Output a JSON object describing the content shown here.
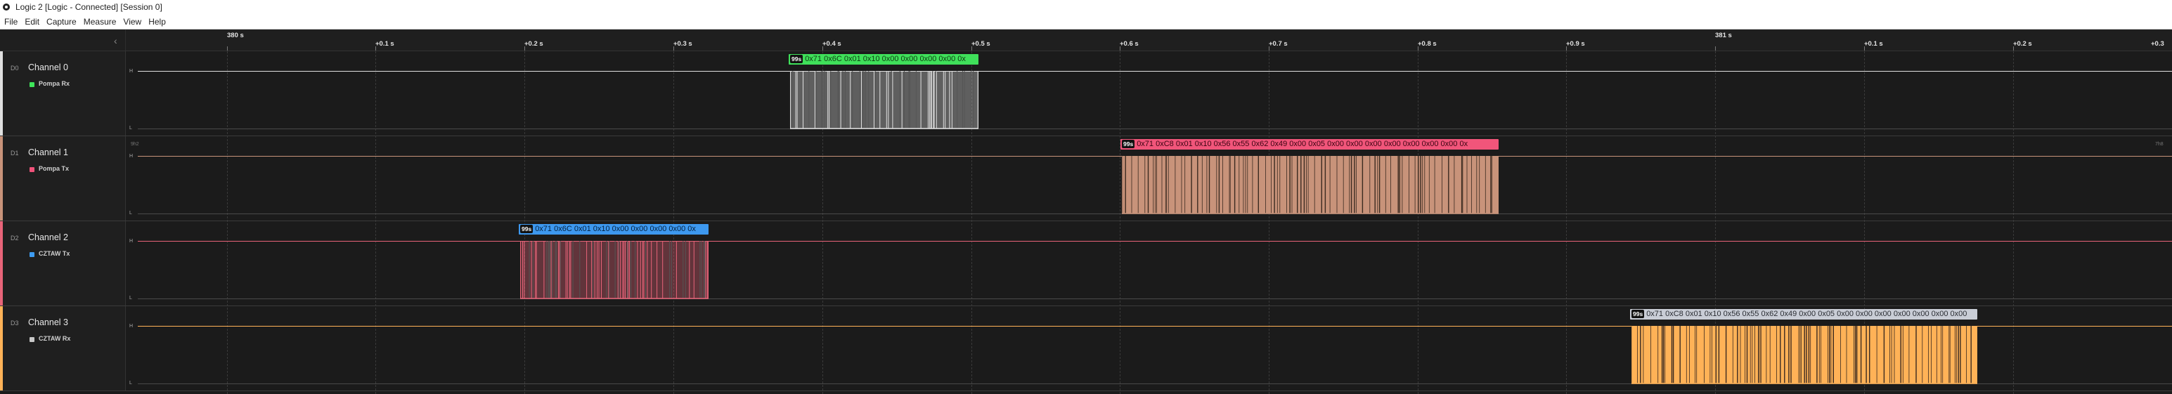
{
  "window": {
    "title": "Logic 2 [Logic - Connected] [Session 0]"
  },
  "menu": [
    "File",
    "Edit",
    "Capture",
    "Measure",
    "View",
    "Help"
  ],
  "ruler": {
    "labels": [
      "380 s",
      "+0.1 s",
      "+0.2 s",
      "+0.3 s",
      "+0.4 s",
      "+0.5 s",
      "+0.6 s",
      "+0.7 s",
      "+0.8 s",
      "+0.9 s",
      "381 s",
      "+0.1 s",
      "+0.2 s",
      "+0.3"
    ]
  },
  "channels": [
    {
      "id": "D0",
      "name": "Channel 0",
      "analyzer": "Pompa Rx",
      "color": "#e0e0e0",
      "analyzer_color": "#3ee65a",
      "high": "H",
      "low": "L",
      "packet": {
        "badge": "99s",
        "text": "0x71 0x6C 0x01 0x10 0x00 0x00 0x00 0x00 0x",
        "bg": "#3fe05a",
        "fg": "#0f3a12"
      }
    },
    {
      "id": "D1",
      "name": "Channel 1",
      "analyzer": "Pompa Tx",
      "color": "#c8937a",
      "analyzer_color": "#f0527a",
      "high": "H",
      "low": "L",
      "corner_left": "9h2",
      "corner_right": "7h8",
      "packet": {
        "badge": "99s",
        "text": "0x71 0xC8 0x01 0x10 0x56 0x55 0x62 0x49 0x00 0x05 0x00 0x00 0x00 0x00 0x00 0x00 0x00 0x",
        "bg": "#f1557a",
        "fg": "#3b0412"
      }
    },
    {
      "id": "D2",
      "name": "Channel 2",
      "analyzer": "CZTAW Tx",
      "color": "#e86479",
      "analyzer_color": "#3d9cf2",
      "high": "H",
      "low": "L",
      "packet": {
        "badge": "99s",
        "text": "0x71 0x6C 0x01 0x10 0x00 0x00 0x00 0x00 0x",
        "bg": "#3d98ef",
        "fg": "#04213f"
      }
    },
    {
      "id": "D3",
      "name": "Channel 3",
      "analyzer": "CZTAW Rx",
      "color": "#ffb257",
      "analyzer_color": "#c8c8c8",
      "high": "H",
      "low": "L",
      "packet": {
        "badge": "99s",
        "text": "0x71 0xC8 0x01 0x10 0x56 0x55 0x62 0x49 0x00 0x05 0x00 0x00 0x00 0x00 0x00 0x00 0x00",
        "bg": "#c9cdd6",
        "fg": "#2a2d33"
      }
    }
  ]
}
